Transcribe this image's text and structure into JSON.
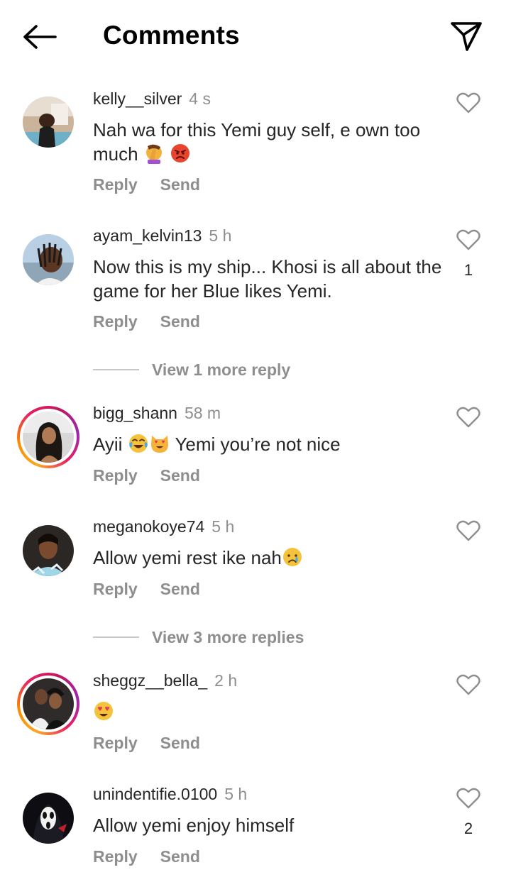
{
  "header": {
    "title": "Comments"
  },
  "action_labels": {
    "reply": "Reply",
    "send": "Send"
  },
  "comments": [
    {
      "username": "kelly__silver",
      "time": "4 s",
      "text": "Nah wa for this Yemi guy self, e own too much",
      "likes": ""
    },
    {
      "username": "ayam_kelvin13",
      "time": "5 h",
      "text": "Now this is my ship... Khosi is all about the game for her Blue likes Yemi.",
      "likes": "1"
    },
    {
      "username": "bigg_shann",
      "time": "58 m",
      "text_prefix": "Ayii",
      "text_suffix": "Yemi you’re not nice",
      "likes": ""
    },
    {
      "username": "meganokoye74",
      "time": "5 h",
      "text": "Allow yemi rest ike nah",
      "likes": ""
    },
    {
      "username": "sheggz__bella_",
      "time": "2 h",
      "text": "",
      "likes": ""
    },
    {
      "username": "unindentifie.0100",
      "time": "5 h",
      "text": "Allow yemi enjoy himself",
      "likes": "2"
    }
  ],
  "view_replies": [
    {
      "label": "View 1 more reply"
    },
    {
      "label": "View 3 more replies"
    }
  ],
  "icons": {
    "back": "arrow-left-icon",
    "send": "paper-plane-icon",
    "like": "heart-outline-icon"
  },
  "colors": {
    "text": "#262626",
    "secondary": "#8e8e8e",
    "story_ring": "#e91e63"
  }
}
